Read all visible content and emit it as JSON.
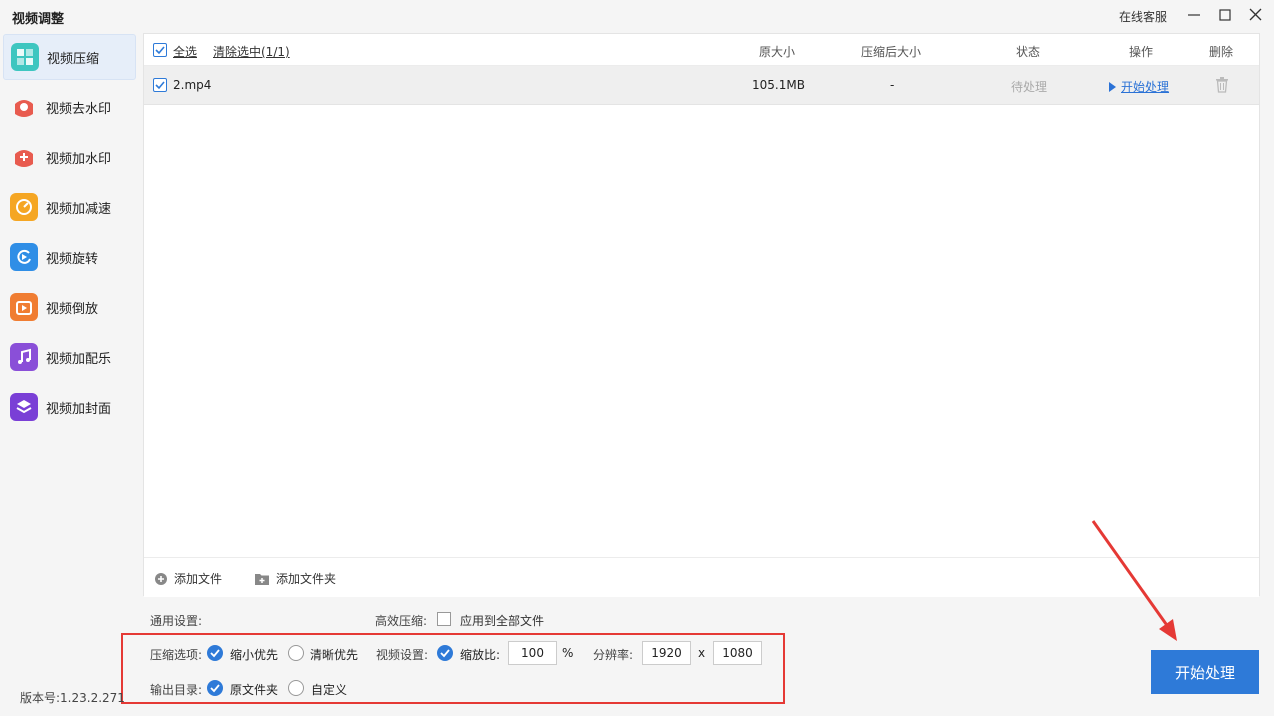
{
  "app": {
    "title": "视频调整",
    "support_label": "在线客服"
  },
  "sidebar": {
    "items": [
      {
        "label": "视频压缩",
        "icon": "compress-icon",
        "color": "#3ec6c0",
        "active": true
      },
      {
        "label": "视频去水印",
        "icon": "remove-watermark-icon",
        "color": "#e85b4f"
      },
      {
        "label": "视频加水印",
        "icon": "add-watermark-icon",
        "color": "#e85b4f"
      },
      {
        "label": "视频加减速",
        "icon": "speed-icon",
        "color": "#f5a623"
      },
      {
        "label": "视频旋转",
        "icon": "rotate-icon",
        "color": "#2f8ee6"
      },
      {
        "label": "视频倒放",
        "icon": "reverse-icon",
        "color": "#f07d32"
      },
      {
        "label": "视频加配乐",
        "icon": "music-icon",
        "color": "#8a4fd8"
      },
      {
        "label": "视频加封面",
        "icon": "cover-icon",
        "color": "#7a3fd6"
      }
    ]
  },
  "table": {
    "select_all": "全选",
    "clear_selection": "清除选中(1/1)",
    "columns": {
      "original_size": "原大小",
      "compressed_size": "压缩后大小",
      "status": "状态",
      "action": "操作",
      "delete": "删除"
    },
    "rows": [
      {
        "name": "2.mp4",
        "original_size": "105.1MB",
        "compressed_size": "-",
        "status": "待处理",
        "action": "开始处理"
      }
    ]
  },
  "footer": {
    "add_file": "添加文件",
    "add_folder": "添加文件夹"
  },
  "settings": {
    "general_label": "通用设置:",
    "efficient_label": "高效压缩:",
    "apply_all_label": "应用到全部文件",
    "compress_option_label": "压缩选项:",
    "option_small": "缩小优先",
    "option_clear": "清晰优先",
    "video_settings_label": "视频设置:",
    "scale_label": "缩放比:",
    "scale_value": "100",
    "percent": "%",
    "resolution_label": "分辨率:",
    "res_width": "1920",
    "res_x": "x",
    "res_height": "1080",
    "output_dir_label": "输出目录:",
    "output_original": "原文件夹",
    "output_custom": "自定义"
  },
  "version": "版本号:1.23.2.271",
  "start_button": "开始处理",
  "colors": {
    "accent": "#2e7ad8",
    "highlight": "#e53935"
  }
}
